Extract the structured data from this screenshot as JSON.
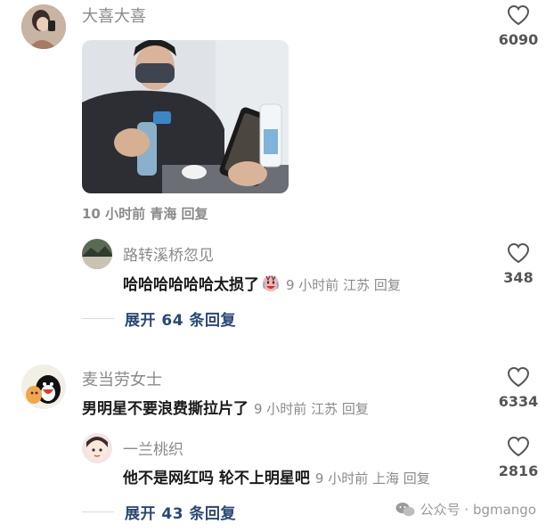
{
  "comments": [
    {
      "username": "大喜大喜",
      "likes": "6090",
      "meta": "10 小时前 青海 回复",
      "replies": [
        {
          "username": "路转溪桥忽见",
          "text": "哈哈哈哈哈哈太损了",
          "meta": "9 小时前 江苏 回复",
          "likes": "348"
        }
      ],
      "expand_label": "展开 64 条回复"
    },
    {
      "username": "麦当劳女士",
      "text": "男明星不要浪费撕拉片了",
      "meta": "9 小时前 江苏 回复",
      "likes": "6334",
      "replies": [
        {
          "username": "一兰桃织",
          "text": "他不是网红吗 轮不上明星吧",
          "meta": "9 小时前 上海 回复",
          "likes": "2816"
        }
      ],
      "expand_label": "展开 43 条回复"
    }
  ],
  "watermark": "公众号 · bgmango",
  "colors": {
    "expand": "#2a4775",
    "meta": "#8a8a8a"
  }
}
